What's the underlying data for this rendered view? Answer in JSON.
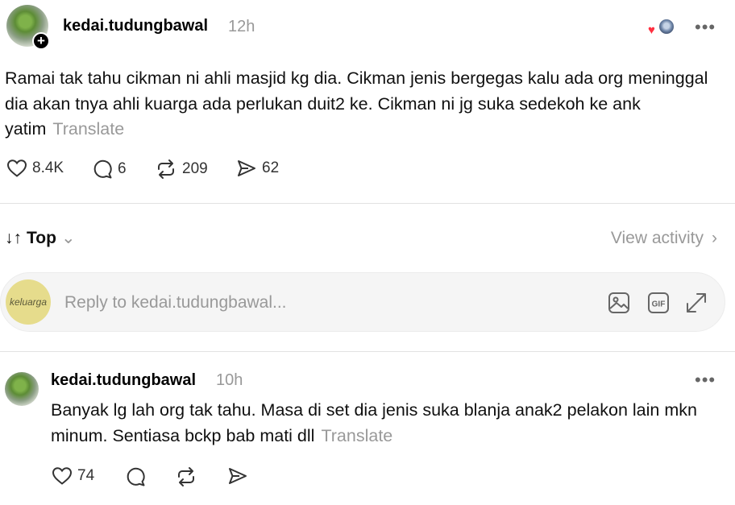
{
  "post": {
    "username": "kedai.tudungbawal",
    "time": "12h",
    "body": "Ramai tak tahu cikman ni ahli masjid kg dia. Cikman jenis bergegas kalu ada org meninggal dia akan tnya ahli kuarga ada perlukan duit2 ke. Cikman ni jg suka sedekoh ke ank yatim",
    "translate_label": "Translate",
    "more_label": "•••",
    "stats": {
      "likes": "8.4K",
      "comments": "6",
      "reposts": "209",
      "shares": "62"
    }
  },
  "sort": {
    "label": "Top",
    "arrows": "↓↑",
    "chevron": "⌄"
  },
  "view_activity": {
    "label": "View activity",
    "chevron": "›"
  },
  "reply": {
    "placeholder": "Reply to kedai.tudungbawal...",
    "avatar_text": "keluarga",
    "gif_label": "GIF"
  },
  "comment": {
    "username": "kedai.tudungbawal",
    "time": "10h",
    "body": "Banyak lg lah org tak tahu. Masa di set dia jenis suka blanja anak2 pelakon lain mkn minum. Sentiasa bckp bab mati dll",
    "translate_label": "Translate",
    "more_label": "•••",
    "stats": {
      "likes": "74"
    }
  },
  "colors": {
    "accent_heart": "#ff3040",
    "muted": "#999999",
    "text": "#101010"
  }
}
